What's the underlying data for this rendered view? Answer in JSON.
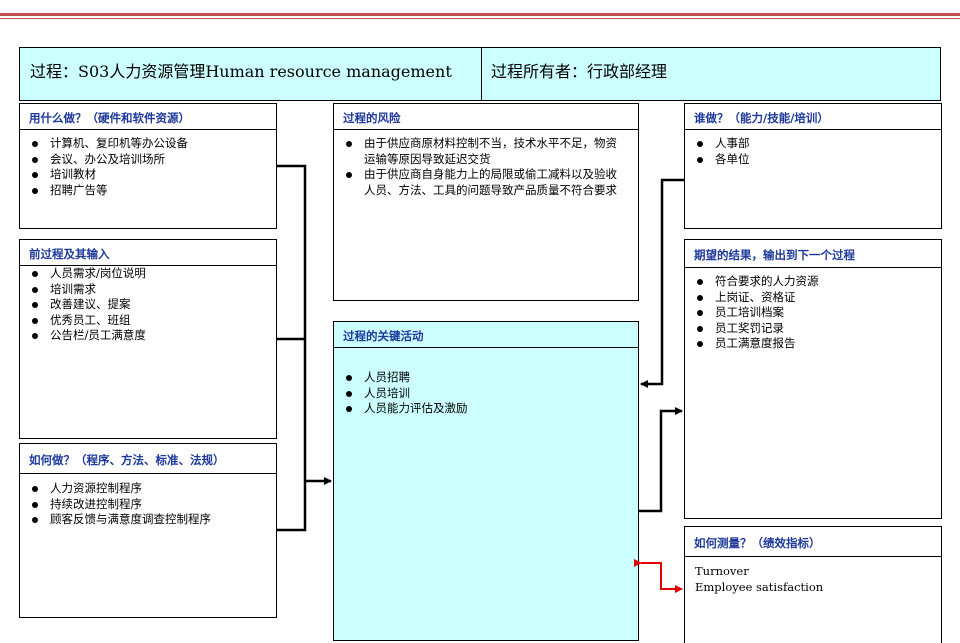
{
  "header": {
    "left": "过程：S03人力资源管理Human resource management",
    "right": "过程所有者：行政部经理"
  },
  "resources": {
    "title": "用什么做？（硬件和软件资源）",
    "items": [
      "计算机、复印机等办公设备",
      "会议、办公及培训场所",
      "培训教材",
      "招聘广告等"
    ]
  },
  "inputs": {
    "title": "前过程及其输入",
    "items": [
      "人员需求/岗位说明",
      "培训需求",
      "改善建议、提案",
      "优秀员工、班组",
      "公告栏/员工满意度"
    ]
  },
  "how": {
    "title": "如何做？（程序、方法、标准、法规）",
    "items": [
      "人力资源控制程序",
      "持续改进控制程序",
      "顾客反馈与满意度调查控制程序"
    ]
  },
  "risk": {
    "title": "过程的风险",
    "items": [
      "由于供应商原材料控制不当，技术水平不足，物资运输等原因导致延迟交货",
      "由于供应商自身能力上的局限或偷工减料以及验收人员、方法、工具的问题导致产品质量不符合要求"
    ]
  },
  "activities": {
    "title": "过程的关键活动",
    "items": [
      "人员招聘",
      "人员培训",
      "人员能力评估及激励"
    ]
  },
  "who": {
    "title": "谁做？（能力/技能/培训）",
    "items": [
      "人事部",
      "各单位"
    ]
  },
  "outputs": {
    "title": "期望的结果，输出到下一个过程",
    "items": [
      "符合要求的人力资源",
      "上岗证、资格证",
      "员工培训档案",
      "员工奖罚记录",
      "员工满意度报告"
    ]
  },
  "measure": {
    "title": "如何测量？（绩效指标）",
    "lines": [
      "Turnover",
      "Employee satisfaction"
    ]
  },
  "colors": {
    "header_bg": "#ccffff",
    "title_text": "#1f3a9c",
    "top_rule": "#c0504d",
    "measure_arrow": "#e00000"
  }
}
